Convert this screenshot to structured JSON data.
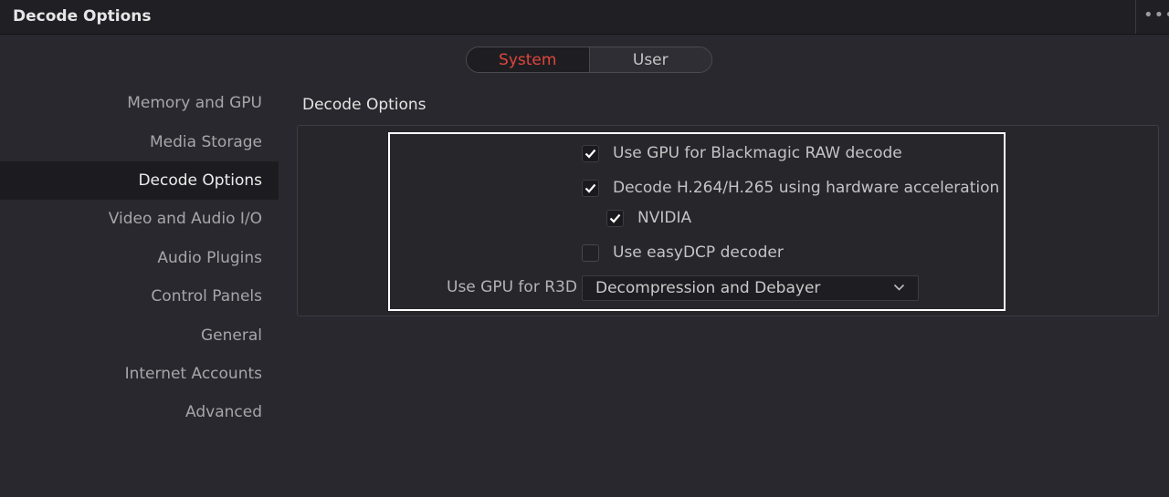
{
  "window": {
    "title": "Decode Options",
    "more_label": "•••"
  },
  "tabs": [
    {
      "label": "System",
      "active": true
    },
    {
      "label": "User",
      "active": false
    }
  ],
  "sidebar": {
    "items": [
      {
        "label": "Memory and GPU"
      },
      {
        "label": "Media Storage"
      },
      {
        "label": "Decode Options",
        "selected": true
      },
      {
        "label": "Video and Audio I/O"
      },
      {
        "label": "Audio Plugins"
      },
      {
        "label": "Control Panels"
      },
      {
        "label": "General"
      },
      {
        "label": "Internet Accounts"
      },
      {
        "label": "Advanced"
      }
    ]
  },
  "main": {
    "section_title": "Decode Options",
    "options": [
      {
        "label": "Use GPU for Blackmagic RAW decode",
        "checked": true
      },
      {
        "label": "Decode H.264/H.265 using hardware acceleration",
        "checked": true
      },
      {
        "label": "NVIDIA",
        "checked": true
      },
      {
        "label": "Use easyDCP decoder",
        "checked": false
      }
    ],
    "r3d": {
      "label": "Use GPU for R3D",
      "value": "Decompression and Debayer"
    }
  },
  "colors": {
    "accent": "#e0463c",
    "background": "#28282e",
    "highlight_border": "#ffffff"
  },
  "icons": {
    "check": "checkmark-icon",
    "dropdown": "chevron-down-icon",
    "more": "ellipsis-icon"
  }
}
